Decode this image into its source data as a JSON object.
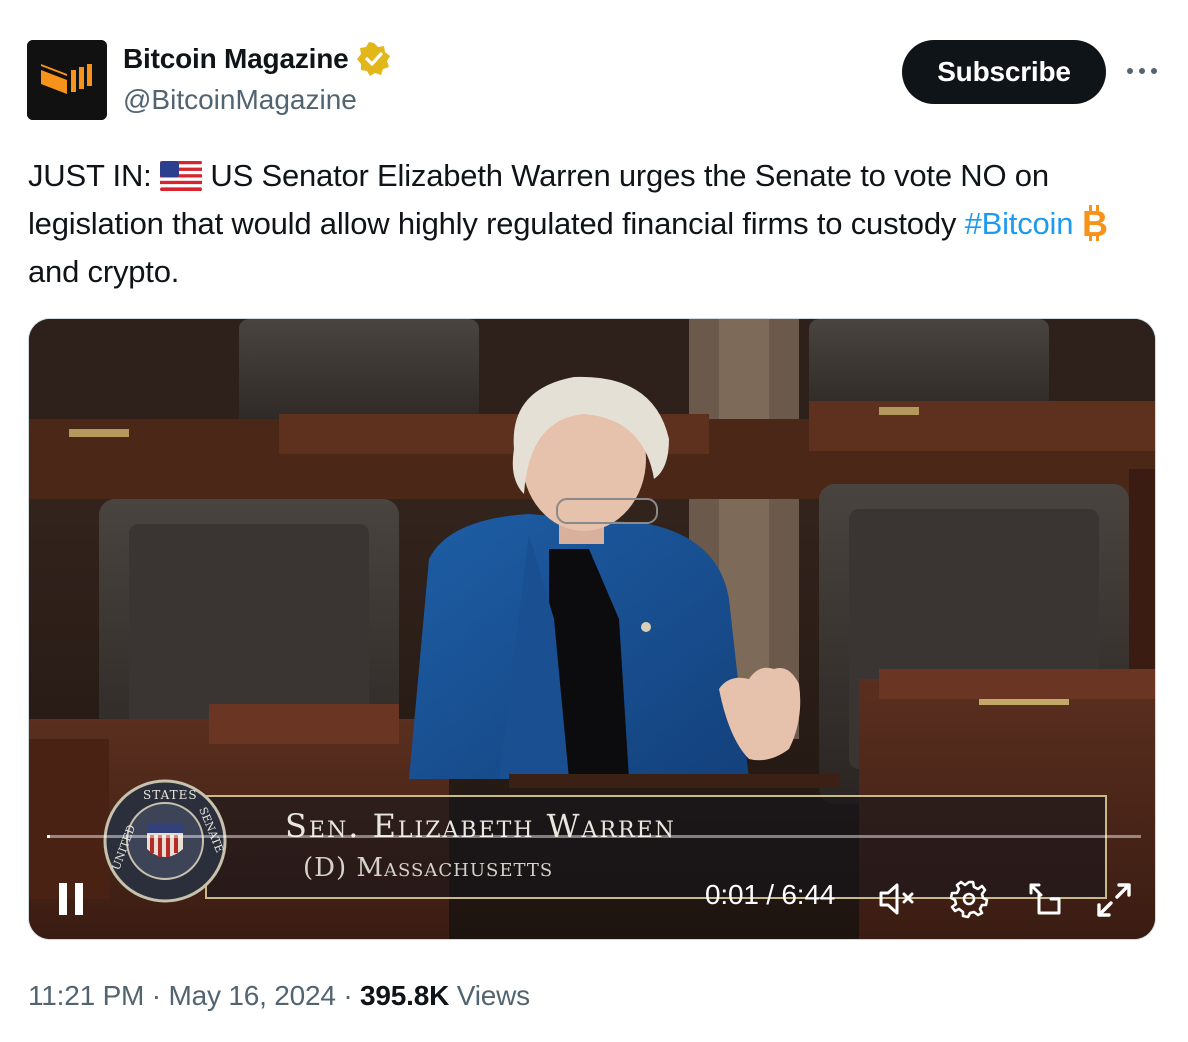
{
  "author": {
    "name": "Bitcoin Magazine",
    "handle": "@BitcoinMagazine",
    "verified": true
  },
  "subscribe_label": "Subscribe",
  "tweet": {
    "prefix": "JUST IN: ",
    "body": " US Senator Elizabeth Warren urges the Senate to vote NO on legislation that would allow highly regulated financial firms to custody ",
    "hashtag": "#Bitcoin",
    "suffix": " and crypto.",
    "emoji_flag": "us-flag-icon",
    "emoji_bitcoin": "bitcoin-icon"
  },
  "video": {
    "lower_third_name": "Sen. Elizabeth Warren",
    "lower_third_state": "(D) Massachusetts",
    "time": "0:01 / 6:44",
    "progress": 0.0025,
    "seal_top": "STATES",
    "seal_left": "UNITED",
    "seal_right": "SENATE"
  },
  "footer": {
    "time": "11:21 PM",
    "sep1": " · ",
    "date": "May 16, 2024",
    "sep2": " · ",
    "views_count": "395.8K",
    "views_label": " Views"
  },
  "colors": {
    "accent": "#1d9bf0",
    "verified_gold": "#e2b719",
    "text": "#0f1419",
    "muted": "#536471"
  }
}
